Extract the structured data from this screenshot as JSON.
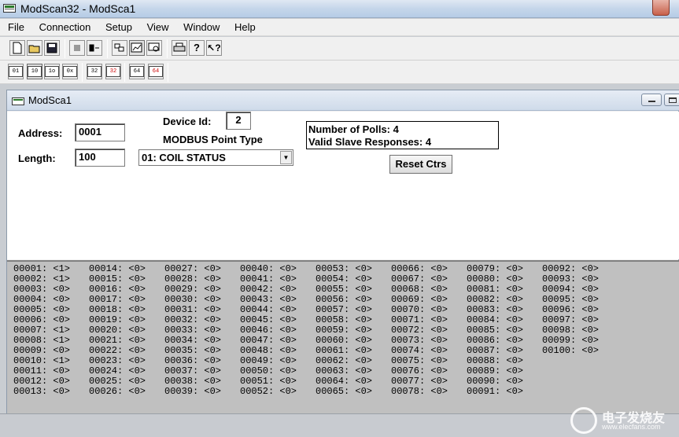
{
  "app": {
    "title": "ModScan32 - ModSca1"
  },
  "menu": [
    "File",
    "Connection",
    "Setup",
    "View",
    "Window",
    "Help"
  ],
  "toolbar2": [
    "01",
    "10",
    "1o",
    "0x",
    "32",
    "32",
    "64",
    "64"
  ],
  "child": {
    "title": "ModSca1"
  },
  "form": {
    "address_label": "Address:",
    "address_value": "0001",
    "length_label": "Length:",
    "length_value": "100",
    "device_id_label": "Device Id:",
    "device_id_value": "2",
    "point_type_label": "MODBUS Point Type",
    "point_type_value": "01: COIL STATUS",
    "polls_text": "Number of Polls: 4",
    "responses_text": "Valid Slave Responses: 4",
    "reset_label": "Reset Ctrs"
  },
  "coils": [
    [
      "00001: <1>",
      "00002: <1>",
      "00003: <0>",
      "00004: <0>",
      "00005: <0>",
      "00006: <0>",
      "00007: <1>",
      "00008: <1>",
      "00009: <0>",
      "00010: <1>",
      "00011: <0>",
      "00012: <0>",
      "00013: <0>"
    ],
    [
      "00014: <0>",
      "00015: <0>",
      "00016: <0>",
      "00017: <0>",
      "00018: <0>",
      "00019: <0>",
      "00020: <0>",
      "00021: <0>",
      "00022: <0>",
      "00023: <0>",
      "00024: <0>",
      "00025: <0>",
      "00026: <0>"
    ],
    [
      "00027: <0>",
      "00028: <0>",
      "00029: <0>",
      "00030: <0>",
      "00031: <0>",
      "00032: <0>",
      "00033: <0>",
      "00034: <0>",
      "00035: <0>",
      "00036: <0>",
      "00037: <0>",
      "00038: <0>",
      "00039: <0>"
    ],
    [
      "00040: <0>",
      "00041: <0>",
      "00042: <0>",
      "00043: <0>",
      "00044: <0>",
      "00045: <0>",
      "00046: <0>",
      "00047: <0>",
      "00048: <0>",
      "00049: <0>",
      "00050: <0>",
      "00051: <0>",
      "00052: <0>"
    ],
    [
      "00053: <0>",
      "00054: <0>",
      "00055: <0>",
      "00056: <0>",
      "00057: <0>",
      "00058: <0>",
      "00059: <0>",
      "00060: <0>",
      "00061: <0>",
      "00062: <0>",
      "00063: <0>",
      "00064: <0>",
      "00065: <0>"
    ],
    [
      "00066: <0>",
      "00067: <0>",
      "00068: <0>",
      "00069: <0>",
      "00070: <0>",
      "00071: <0>",
      "00072: <0>",
      "00073: <0>",
      "00074: <0>",
      "00075: <0>",
      "00076: <0>",
      "00077: <0>",
      "00078: <0>"
    ],
    [
      "00079: <0>",
      "00080: <0>",
      "00081: <0>",
      "00082: <0>",
      "00083: <0>",
      "00084: <0>",
      "00085: <0>",
      "00086: <0>",
      "00087: <0>",
      "00088: <0>",
      "00089: <0>",
      "00090: <0>",
      "00091: <0>"
    ],
    [
      "00092: <0>",
      "00093: <0>",
      "00094: <0>",
      "00095: <0>",
      "00096: <0>",
      "00097: <0>",
      "00098: <0>",
      "00099: <0>",
      "00100: <0>"
    ]
  ],
  "watermark": {
    "text": "电子发烧友",
    "url": "www.elecfans.com"
  }
}
